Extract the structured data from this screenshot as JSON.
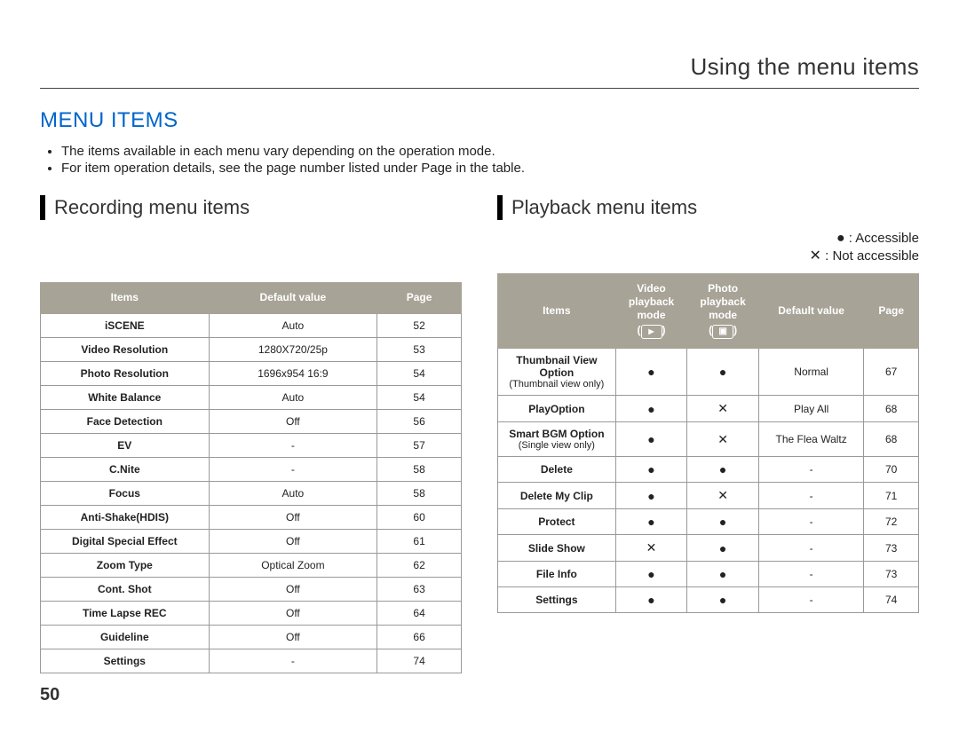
{
  "header": {
    "right": "Using the menu items"
  },
  "title": "MENU ITEMS",
  "bullets": [
    "The items available in each menu vary depending on the operation mode.",
    "For item operation details, see the page number listed under Page in the table."
  ],
  "recording": {
    "subhead": "Recording menu items",
    "headers": [
      "Items",
      "Default value",
      "Page"
    ],
    "rows": [
      {
        "item": "iSCENE",
        "default": "Auto",
        "page": "52"
      },
      {
        "item": "Video Resolution",
        "default": "1280X720/25p",
        "page": "53"
      },
      {
        "item": "Photo Resolution",
        "default": "1696x954 16:9",
        "page": "54"
      },
      {
        "item": "White Balance",
        "default": "Auto",
        "page": "54"
      },
      {
        "item": "Face Detection",
        "default": "Off",
        "page": "56"
      },
      {
        "item": "EV",
        "default": "-",
        "page": "57"
      },
      {
        "item": "C.Nite",
        "default": "-",
        "page": "58"
      },
      {
        "item": "Focus",
        "default": "Auto",
        "page": "58"
      },
      {
        "item": "Anti-Shake(HDIS)",
        "default": "Off",
        "page": "60"
      },
      {
        "item": "Digital Special Effect",
        "default": "Off",
        "page": "61"
      },
      {
        "item": "Zoom Type",
        "default": "Optical Zoom",
        "page": "62"
      },
      {
        "item": "Cont. Shot",
        "default": "Off",
        "page": "63"
      },
      {
        "item": "Time Lapse REC",
        "default": "Off",
        "page": "64"
      },
      {
        "item": "Guideline",
        "default": "Off",
        "page": "66"
      },
      {
        "item": "Settings",
        "default": "-",
        "page": "74"
      }
    ]
  },
  "playback": {
    "subhead": "Playback menu items",
    "legend": {
      "accessible": ": Accessible",
      "not_accessible": ": Not accessible",
      "dot": "●",
      "cross": "✕"
    },
    "headers": {
      "items": "Items",
      "video": "Video playback mode",
      "photo": "Photo playback mode",
      "default": "Default value",
      "page": "Page"
    },
    "rows": [
      {
        "item": "Thumbnail View Option",
        "note": "(Thumbnail view only)",
        "video": "●",
        "photo": "●",
        "default": "Normal",
        "page": "67"
      },
      {
        "item": "PlayOption",
        "note": "",
        "video": "●",
        "photo": "✕",
        "default": "Play All",
        "page": "68"
      },
      {
        "item": "Smart BGM Option",
        "note": "(Single view only)",
        "video": "●",
        "photo": "✕",
        "default": "The Flea Waltz",
        "page": "68"
      },
      {
        "item": "Delete",
        "note": "",
        "video": "●",
        "photo": "●",
        "default": "-",
        "page": "70"
      },
      {
        "item": "Delete My Clip",
        "note": "",
        "video": "●",
        "photo": "✕",
        "default": "-",
        "page": "71"
      },
      {
        "item": "Protect",
        "note": "",
        "video": "●",
        "photo": "●",
        "default": "-",
        "page": "72"
      },
      {
        "item": "Slide Show",
        "note": "",
        "video": "✕",
        "photo": "●",
        "default": "-",
        "page": "73"
      },
      {
        "item": "File Info",
        "note": "",
        "video": "●",
        "photo": "●",
        "default": "-",
        "page": "73"
      },
      {
        "item": "Settings",
        "note": "",
        "video": "●",
        "photo": "●",
        "default": "-",
        "page": "74"
      }
    ]
  },
  "page_number": "50"
}
